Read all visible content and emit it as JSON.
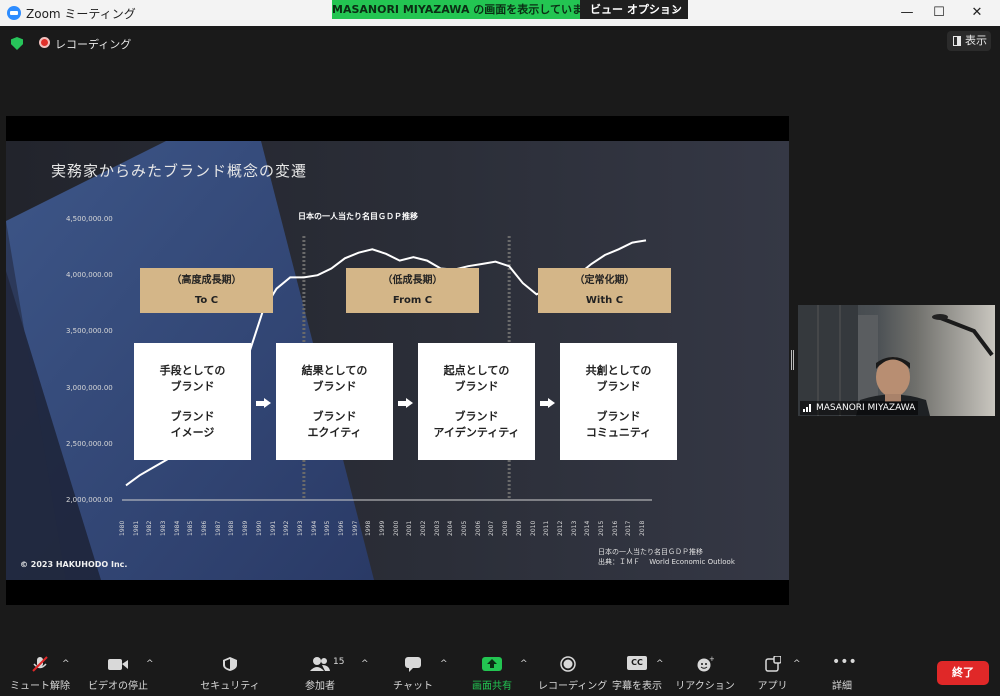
{
  "window": {
    "title": "Zoom ミーティング",
    "share_banner": "MASANORI MIYAZAWA の画面を表示しています",
    "view_options": "ビュー オプション",
    "controls": {
      "minimize": "—",
      "maximize": "☐",
      "close": "✕"
    }
  },
  "meeting": {
    "recording_label": "レコーディング",
    "view_button": "表示"
  },
  "slide": {
    "title": "実務家からみたブランド概念の変遷",
    "copyright": "© 2023 HAKUHODO Inc.",
    "source_line1": "日本の一人当たり名目ＧＤＰ推移",
    "source_line2": "出典：ＩＭＦ　 World Economic Outlook",
    "phases": [
      {
        "line1": "（高度成長期）",
        "line2": "To C"
      },
      {
        "line1": "（低成長期）",
        "line2": "From C"
      },
      {
        "line1": "（定常化期）",
        "line2": "With C"
      }
    ],
    "concepts": [
      {
        "line1": "手段としての",
        "line2": "ブランド",
        "line3": "ブランド",
        "line4": "イメージ"
      },
      {
        "line1": "結果としての",
        "line2": "ブランド",
        "line3": "ブランド",
        "line4": "エクイティ"
      },
      {
        "line1": "起点としての",
        "line2": "ブランド",
        "line3": "ブランド",
        "line4": "アイデンティティ"
      },
      {
        "line1": "共創としての",
        "line2": "ブランド",
        "line3": "ブランド",
        "line4": "コミュニティ"
      }
    ]
  },
  "chart_data": {
    "type": "line",
    "title": "日本の一人当たり名目ＧＤＰ推移",
    "x": [
      1980,
      1981,
      1982,
      1983,
      1984,
      1985,
      1986,
      1987,
      1988,
      1989,
      1990,
      1991,
      1992,
      1993,
      1994,
      1995,
      1996,
      1997,
      1998,
      1999,
      2000,
      2001,
      2002,
      2003,
      2004,
      2005,
      2006,
      2007,
      2008,
      2009,
      2010,
      2011,
      2012,
      2013,
      2014,
      2015,
      2016,
      2017,
      2018
    ],
    "x_tick_labels": [
      "1980",
      "1981",
      "1982",
      "1983",
      "1984",
      "1985",
      "1986",
      "1987",
      "1988",
      "1989",
      "1990",
      "1991",
      "1992",
      "1993",
      "1994",
      "1995",
      "1996",
      "1997",
      "1998",
      "1999",
      "2000",
      "2001",
      "2002",
      "2003",
      "2004",
      "2005",
      "2006",
      "2007",
      "2008",
      "2009",
      "2010",
      "2011",
      "2012",
      "2013",
      "2014",
      "2015",
      "2016",
      "2017",
      "2018"
    ],
    "y": [
      2130000,
      2220000,
      2290000,
      2360000,
      2450000,
      2590000,
      2700000,
      2830000,
      3030000,
      3310000,
      3680000,
      3880000,
      3980000,
      3980000,
      4000000,
      4060000,
      4150000,
      4200000,
      4230000,
      4190000,
      4130000,
      4160000,
      4130000,
      4060000,
      4050000,
      4080000,
      4100000,
      4120000,
      4080000,
      3930000,
      3830000,
      3880000,
      3900000,
      4000000,
      4100000,
      4180000,
      4230000,
      4290000,
      4310000
    ],
    "ylim": [
      2000000,
      4500000
    ],
    "y_tick_labels": [
      "4,500,000.00",
      "4,000,000.00",
      "3,500,000.00",
      "3,000,000.00",
      "2,500,000.00",
      "2,000,000.00"
    ],
    "y_tick_values": [
      4500000,
      4000000,
      3500000,
      3000000,
      2500000,
      2000000
    ],
    "dividers_at": [
      1993,
      2008
    ]
  },
  "participant": {
    "name": "MASANORI MIYAZAWA"
  },
  "toolbar": {
    "mute_label": "ミュート解除",
    "video_label": "ビデオの停止",
    "security_label": "セキュリティ",
    "participants_label": "参加者",
    "participants_count": "15",
    "chat_label": "チャット",
    "share_label": "画面共有",
    "record_label": "レコーディング",
    "captions_label": "字幕を表示",
    "captions_icon_text": "CC",
    "reactions_label": "リアクション",
    "apps_label": "アプリ",
    "more_label": "詳細",
    "end_label": "終了"
  }
}
